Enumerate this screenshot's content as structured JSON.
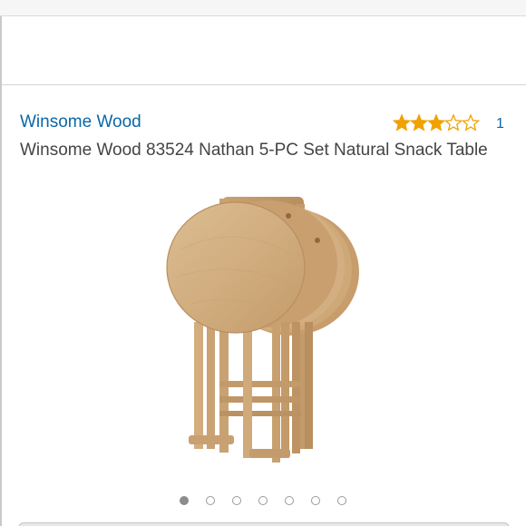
{
  "product": {
    "brand": "Winsome Wood",
    "title": "Winsome Wood 83524 Nathan 5-PC Set Natural Snack Table",
    "rating": {
      "stars": 3,
      "max_stars": 5,
      "review_count": "1",
      "star_color": "#f1a100"
    },
    "image": {
      "alt_subject": "folding-wooden-snack-tables-on-stand",
      "wood_color": "#d4b184"
    }
  },
  "carousel": {
    "total": 7,
    "active_index": 0
  },
  "colors": {
    "link": "#0a67a8",
    "title_text": "#444444"
  }
}
